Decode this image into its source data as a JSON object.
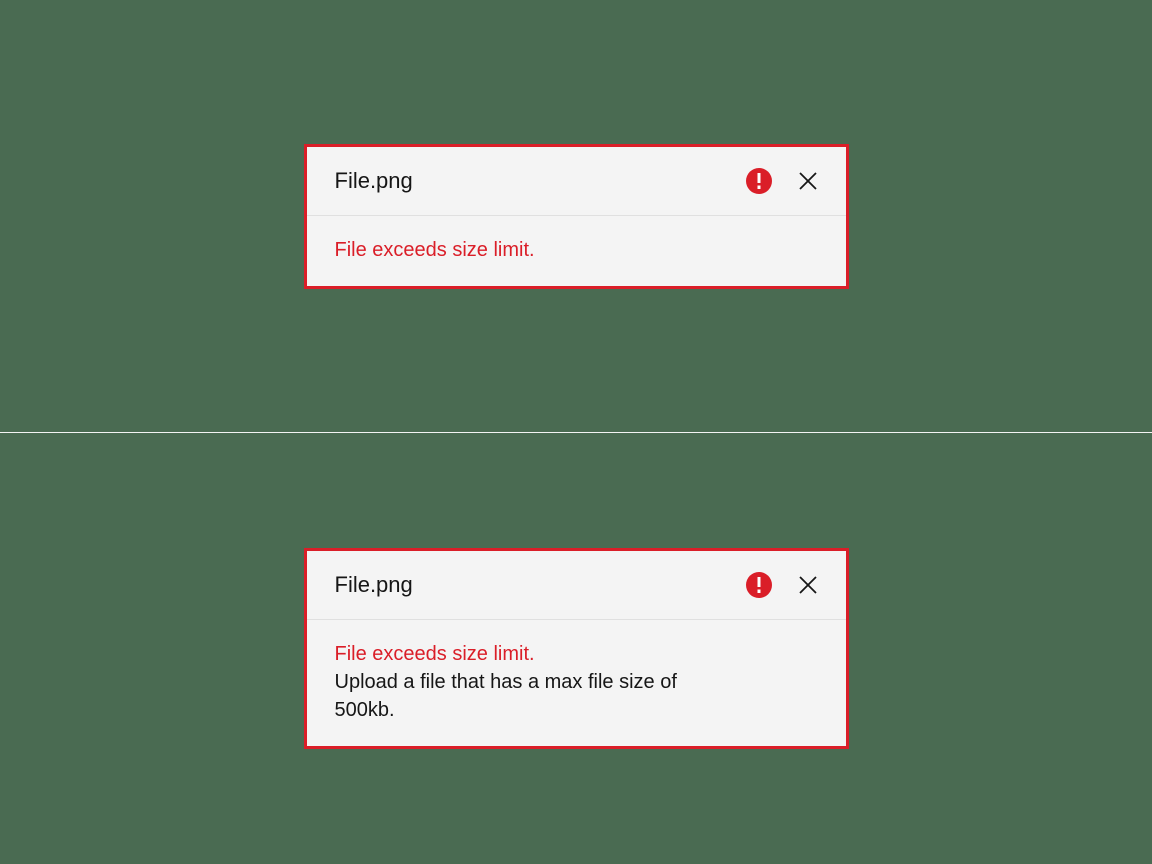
{
  "cards": [
    {
      "filename": "File.png",
      "error_subject": "File exceeds size limit.",
      "error_detail": ""
    },
    {
      "filename": "File.png",
      "error_subject": "File exceeds size limit.",
      "error_detail": "Upload a file that has a max file size of 500kb."
    }
  ],
  "colors": {
    "error": "#da1e28",
    "background": "#4a6b52",
    "card_bg": "#f4f4f4",
    "text": "#161616"
  }
}
